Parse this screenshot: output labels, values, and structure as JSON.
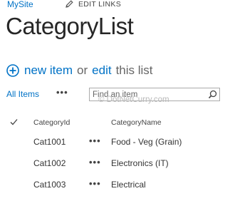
{
  "site": {
    "name": "MySite",
    "edit_links_label": "EDIT LINKS",
    "edit_icon": "pencil-icon"
  },
  "page_title": "CategoryList",
  "actions": {
    "add_icon": "plus-circle-icon",
    "new_item_label": "new item",
    "or_text": "or",
    "edit_label": "edit",
    "this_list_text": "this list"
  },
  "view": {
    "current_view": "All Items",
    "more_label": "•••"
  },
  "search": {
    "placeholder": "Find an item",
    "icon": "search-icon"
  },
  "watermark": "© DotNetCurry.com",
  "table": {
    "select_all_icon": "checkmark-icon",
    "columns": [
      "CategoryId",
      "CategoryName"
    ],
    "row_menu_label": "•••",
    "rows": [
      {
        "id": "Cat1001",
        "name": "Food - Veg (Grain)"
      },
      {
        "id": "Cat1002",
        "name": "Electronics (IT)"
      },
      {
        "id": "Cat1003",
        "name": "Electrical"
      }
    ]
  },
  "colors": {
    "link_blue": "#0072c6",
    "title_text": "#262626",
    "body_text": "#444444"
  }
}
